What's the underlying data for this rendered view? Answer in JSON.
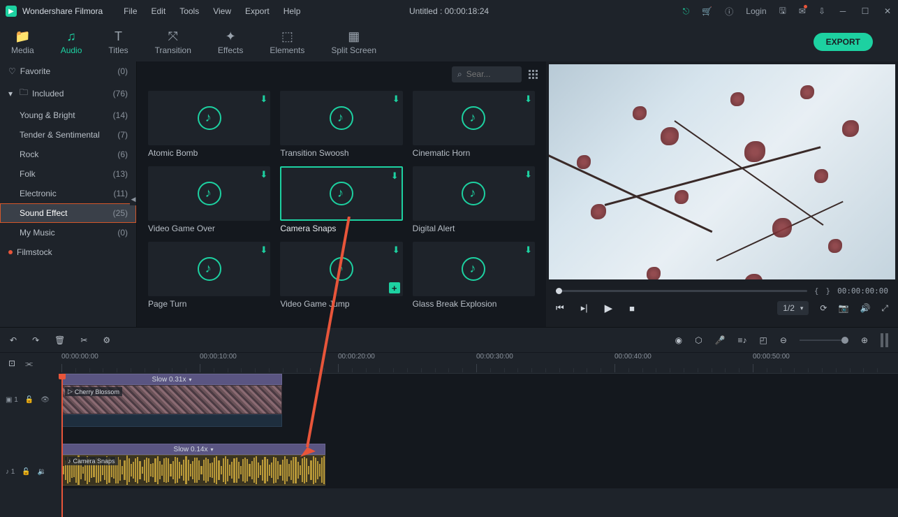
{
  "app": {
    "name": "Wondershare Filmora",
    "title": "Untitled : 00:00:18:24",
    "login": "Login"
  },
  "menu": [
    "File",
    "Edit",
    "Tools",
    "View",
    "Export",
    "Help"
  ],
  "tabs": [
    {
      "label": "Media"
    },
    {
      "label": "Audio"
    },
    {
      "label": "Titles"
    },
    {
      "label": "Transition"
    },
    {
      "label": "Effects"
    },
    {
      "label": "Elements"
    },
    {
      "label": "Split Screen"
    }
  ],
  "export_btn": "EXPORT",
  "sidebar": [
    {
      "label": "Favorite",
      "count": "(0)",
      "type": "fav"
    },
    {
      "label": "Included",
      "count": "(76)",
      "type": "folder"
    },
    {
      "label": "Young & Bright",
      "count": "(14)",
      "type": "sub"
    },
    {
      "label": "Tender & Sentimental",
      "count": "(7)",
      "type": "sub"
    },
    {
      "label": "Rock",
      "count": "(6)",
      "type": "sub"
    },
    {
      "label": "Folk",
      "count": "(13)",
      "type": "sub"
    },
    {
      "label": "Electronic",
      "count": "(11)",
      "type": "sub"
    },
    {
      "label": "Sound Effect",
      "count": "(25)",
      "type": "sub",
      "selected": true
    },
    {
      "label": "My Music",
      "count": "(0)",
      "type": "sub"
    },
    {
      "label": "Filmstock",
      "count": "",
      "type": "stock"
    }
  ],
  "search": {
    "placeholder": "Sear..."
  },
  "assets": [
    {
      "name": "Atomic Bomb"
    },
    {
      "name": "Transition Swoosh"
    },
    {
      "name": "Cinematic Horn"
    },
    {
      "name": "Video Game Over"
    },
    {
      "name": "Camera Snaps",
      "selected": true
    },
    {
      "name": "Digital Alert"
    },
    {
      "name": "Page Turn"
    },
    {
      "name": "Video Game Jump",
      "add": true
    },
    {
      "name": "Glass Break Explosion"
    }
  ],
  "player": {
    "time": "00:00:00:00",
    "page": "1/2"
  },
  "ruler": [
    "00:00:00:00",
    "00:00:10:00",
    "00:00:20:00",
    "00:00:30:00",
    "00:00:40:00",
    "00:00:50:00"
  ],
  "tracks": {
    "video": {
      "speed": "Slow 0.31x",
      "clip_name": "Cherry Blossom"
    },
    "audio": {
      "speed": "Slow 0.14x",
      "clip_name": "Camera Snaps"
    }
  }
}
